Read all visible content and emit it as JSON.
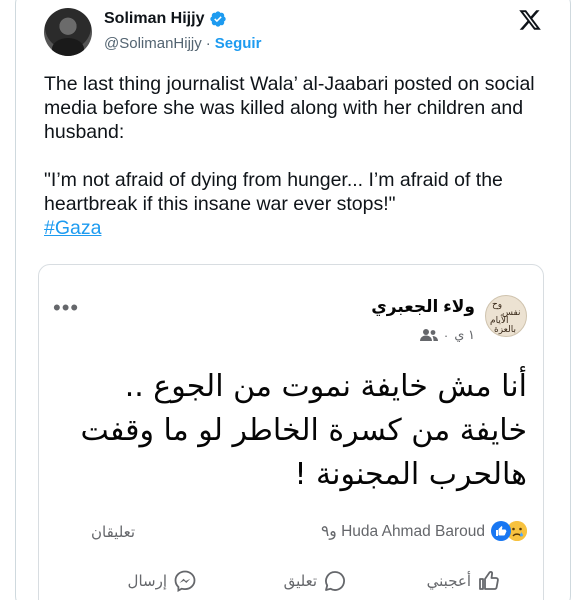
{
  "tweet": {
    "author_name": "Soliman Hijjy",
    "handle": "@SolimanHijjy",
    "separator": "·",
    "follow_label": "Seguir",
    "paragraphs": [
      "The last thing journalist Wala’ al-Jaabari posted on social media before she was killed along with her children and husband:",
      "\"I’m not afraid of dying from hunger... I’m afraid of the heartbreak if this insane war ever stops!\""
    ],
    "hashtag": "#Gaza"
  },
  "embed": {
    "author_name": "ولاء الجعبري",
    "time": "١ ي",
    "dot": "·",
    "post_text": "أنا مش خايفة نموت من الجوع .. خايفة من كسرة الخاطر لو ما وقفت هالحرب المجنونة !",
    "reactions_text": "Huda Ahmad Baroud و٩",
    "comments_label": "تعليقان",
    "actions": {
      "like": "أعجبني",
      "comment": "تعليق",
      "send": "إرسال"
    },
    "avatar_text": [
      "وح",
      "نفس",
      "الأيام",
      "بالعزة"
    ]
  },
  "colors": {
    "accent": "#1d9bf0",
    "text": "#0f1419",
    "muted": "#536471"
  }
}
